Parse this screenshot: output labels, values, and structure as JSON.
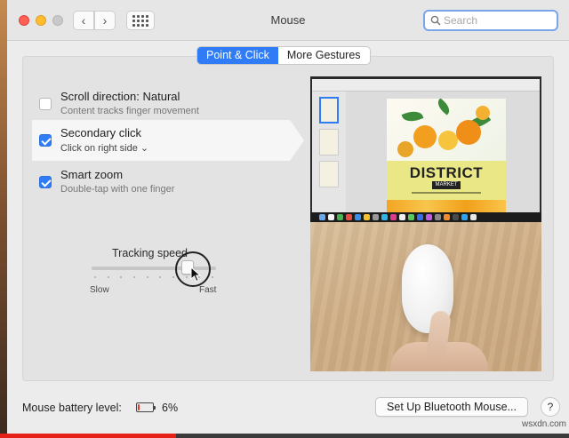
{
  "window": {
    "title": "Mouse"
  },
  "search": {
    "placeholder": "Search"
  },
  "tabs": [
    {
      "label": "Point & Click",
      "active": true
    },
    {
      "label": "More Gestures",
      "active": false
    }
  ],
  "options": [
    {
      "title": "Scroll direction: Natural",
      "subtitle": "Content tracks finger movement",
      "checked": false,
      "selected": false
    },
    {
      "title": "Secondary click",
      "subtitle": "Click on right side ⌄",
      "checked": true,
      "selected": true
    },
    {
      "title": "Smart zoom",
      "subtitle": "Double-tap with one finger",
      "checked": true,
      "selected": false
    }
  ],
  "tracking": {
    "label": "Tracking speed",
    "min_label": "Slow",
    "max_label": "Fast",
    "value_fraction": 0.8,
    "tick_count": 10
  },
  "preview": {
    "doc_title": "DISTRICT",
    "doc_subtitle": "MARKET"
  },
  "battery": {
    "label": "Mouse battery level:",
    "percent_text": "6%",
    "level_fraction": 0.06,
    "color": "#e03a2f"
  },
  "buttons": {
    "bluetooth": "Set Up Bluetooth Mouse...",
    "help": "?"
  },
  "accent_color": "#2f7cf6",
  "video_progress_fraction": 0.31,
  "watermark": "wsxdn.com"
}
